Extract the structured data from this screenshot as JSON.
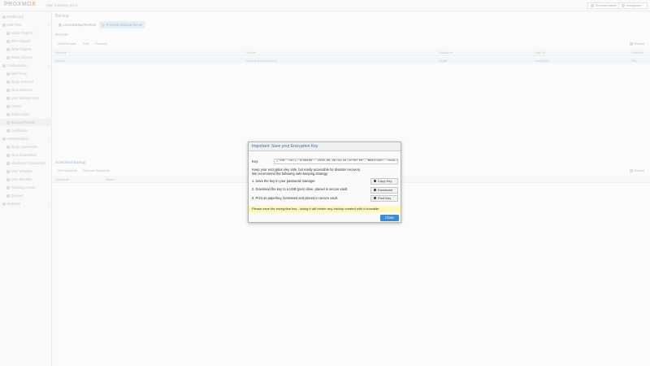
{
  "header": {
    "logo_text": "PROXMO",
    "logo_x": "X",
    "product": "Mail Gateway 9.0.0",
    "documentation_label": "Documentation",
    "user_label": "root@pam"
  },
  "sidebar": {
    "items": [
      {
        "label": "Dashboard",
        "icon": "dashboard-icon"
      },
      {
        "label": "Mail Flow",
        "icon": "envelope-icon",
        "expand": "v"
      },
      {
        "label": "Action Objects",
        "icon": "gear-icon"
      },
      {
        "label": "Who Objects",
        "icon": "user-icon"
      },
      {
        "label": "What Objects",
        "icon": "cog-icon"
      },
      {
        "label": "When Objects",
        "icon": "clock-icon"
      },
      {
        "label": "Configuration",
        "icon": "gear-icon",
        "expand": "v"
      },
      {
        "label": "Mail Proxy",
        "icon": "envelope-icon"
      },
      {
        "label": "Spam Detector",
        "icon": "bullhorn-icon"
      },
      {
        "label": "Virus Detector",
        "icon": "bug-icon"
      },
      {
        "label": "User Management",
        "icon": "users-icon"
      },
      {
        "label": "Cluster",
        "icon": "cubes-icon"
      },
      {
        "label": "Subscription",
        "icon": "support-icon"
      },
      {
        "label": "Backup/Restore",
        "icon": "floppy-icon"
      },
      {
        "label": "Certificates",
        "icon": "certificate-icon"
      },
      {
        "label": "Administration",
        "icon": "wrench-icon",
        "expand": "v"
      },
      {
        "label": "Spam Quarantine",
        "icon": "bullhorn-icon"
      },
      {
        "label": "Virus Quarantine",
        "icon": "bug-icon"
      },
      {
        "label": "Attachment Quarantine",
        "icon": "paperclip-icon"
      },
      {
        "label": "User Whitelist",
        "icon": "file-icon"
      },
      {
        "label": "User Blacklist",
        "icon": "file-icon"
      },
      {
        "label": "Tracking Center",
        "icon": "map-icon"
      },
      {
        "label": "Queues",
        "icon": "bars-icon"
      },
      {
        "label": "Statistics",
        "icon": "bar-chart-icon",
        "expand": "<"
      }
    ]
  },
  "main": {
    "title": "Backup",
    "tabs": [
      {
        "label": "Local Backup/Restore"
      },
      {
        "label": "Proxmox Backup Server"
      }
    ],
    "remote_section": "Remote",
    "toolbar": {
      "add": "Add Remote",
      "edit": "Edit",
      "remove": "Remove",
      "reload": "Reload"
    },
    "grid_headers": [
      "Remote ↑",
      "Server",
      "Datastore",
      "User ID",
      "Enabled"
    ],
    "rows": [
      [
        "backup",
        "backup.proxmox.com",
        "target",
        "root@pam",
        "Yes"
      ]
    ],
    "schedule_section": "Scheduled Backup",
    "schedule_toolbar": {
      "set": "Set Schedule",
      "remove": "Remove Schedule",
      "reload": "Reload"
    },
    "schedule_headers": [
      "Schedule",
      "Name"
    ]
  },
  "dialog": {
    "title": "Important: Save your Encryption Key",
    "key_label": "Key:",
    "key_value": "{\"kdf\":null,\"created\":\"2026-06-09T16:56:45+00:00\",\"modified\":\"2026-06-09T16:56:4",
    "intro_line1": "Keep your encryption key safe, but easily accessible for disaster recovery.",
    "intro_line2": "We recommend the following safe-keeping strategy:",
    "step1": "1. Save the key in your password manager.",
    "step2": "2. Download the key to a USB (pen) drive, placed in secure vault.",
    "step3": "3. Print as paperkey, laminated and placed in secure vault.",
    "buttons": {
      "copy": "Copy Key",
      "download": "Download",
      "print": "Print Key"
    },
    "warning": "Please save the encryption key - losing it will render any backup created with it unusable",
    "close": "Close"
  }
}
